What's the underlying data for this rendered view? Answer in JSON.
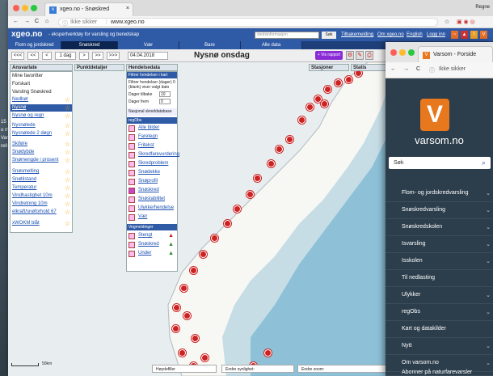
{
  "desktop": {
    "side_text": "15\no m\nVar\nrell"
  },
  "win1": {
    "tab_title": "xgeo.no - Snøskred",
    "url_prefix": "Ikke sikker",
    "url": "www.xgeo.no",
    "user_label": "Regne"
  },
  "xgeo": {
    "logo": "xgeo.no",
    "subtitle": "- ekspertverktøy for varsling og beredskap",
    "search_placeholder": "stedsinformasjon",
    "search_button": "Søk",
    "links": [
      "Tilbakemelding",
      "Om xgeo.no",
      "English",
      "Logg inn"
    ],
    "nav_tabs": [
      "Flom og jordskred",
      "Snøskred",
      "Vær",
      "Bare",
      "Alle data"
    ],
    "active_tab": "Snøskred",
    "toolbar": {
      "first": "<<<",
      "prev2": "<<",
      "prev": "<",
      "period": "1 dag",
      "next": ">",
      "next2": ">>",
      "last": ">>>"
    },
    "date": "04.04.2018",
    "map_title": "Nysnø onsdag",
    "vis_button": "+ Vis rapport"
  },
  "left_panel": {
    "header": "Ansvarlate",
    "sections": [
      "Mine favoritter",
      "Forskart",
      "Varsling Snøskred"
    ],
    "items": [
      "Nedbør",
      "Nysnø",
      "Nysnø og regn",
      "Nysnølede",
      "Nysnølede 2 døgn",
      "Skiføre",
      "Snødybde",
      "Snømengde i prosent",
      "Snøsmelting",
      "Snøtilstand",
      "Temperatur",
      "Vindhastighet 10m",
      "Vindretning 10m",
      "elkraft/snøforhold 67",
      "xWOKM blåt"
    ]
  },
  "mid_panel": {
    "header": "Punktdetaljer"
  },
  "obs_panel": {
    "header": "Hendelsedata",
    "filter_title": "Filtrer hendelser i kart",
    "filter_help": "Filtrer hendelser (dager) 0 (blank) viser valgt dato",
    "days_back_label": "Dager tilbake",
    "days_back_value": "10",
    "days_forward_label": "Dager frem",
    "days_forward_value": "0",
    "nasjonal": "Nasjonal skreddatabase",
    "regobs": "regObs",
    "regobs_items": [
      "Alle bilder",
      "Faretegn",
      "Fritekst",
      "Skredfarevurdering",
      "Skredproblem",
      "Snødekke",
      "Snøprofil",
      "Snøskred",
      "Snøstabilitet",
      "Ulykke/hendelse",
      "Vær"
    ],
    "vegmeldinger": "Vegmeldinger",
    "veg_items": [
      "Stengt",
      "Snøskred",
      "Under"
    ]
  },
  "right_panel": {
    "header1": "Stasjoner",
    "header2": "Statis"
  },
  "bottom": {
    "scale": "50km",
    "haydefiller": "Høydefiller",
    "endre_synlighet": "Endre synlighet:",
    "endre_zoom": "Endre zoom:"
  },
  "win2": {
    "tab_title": "Varsom - Forside",
    "url_prefix": "Ikke sikker",
    "logo_letter": "V",
    "site_name": "varsom.no",
    "search_placeholder": "Søk",
    "menu": [
      "Flom- og jordskredvarsling",
      "Snøskredvarsling",
      "Snøskredskolen",
      "Isvarsling",
      "Isskolen",
      "Til nedlasting",
      "Ulykker",
      "regObs",
      "Kart og datakilder",
      "Nytt",
      "Om varsom.no",
      "Abonner på naturfarevarsler"
    ]
  },
  "colors": {
    "xgeo_blue": "#2f5aa6",
    "varsom_orange": "#e8781e",
    "marker_red": "#cc2222",
    "varsom_bg": "#2c3e4c"
  }
}
